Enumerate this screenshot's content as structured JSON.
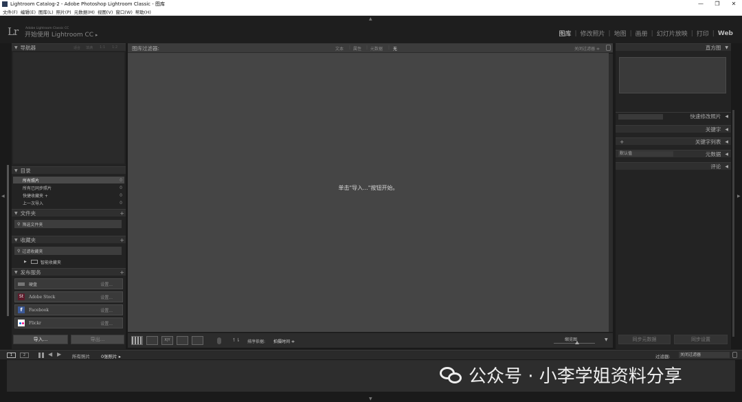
{
  "window": {
    "title": "Lightroom Catalog-2 - Adobe Photoshop Lightroom Classic - 图库",
    "controls": [
      "—",
      "❐",
      "✕"
    ]
  },
  "menu": [
    "文件(F)",
    "编辑(E)",
    "图库(L)",
    "照片(P)",
    "元数据(M)",
    "视图(V)",
    "窗口(W)",
    "帮助(H)"
  ],
  "identity": {
    "logo": "Lr",
    "sub": "Adobe Lightroom Classic CC",
    "main": "开始使用 Lightroom CC",
    "arrow": "▸"
  },
  "modules": [
    "图库",
    "修改照片",
    "地图",
    "画册",
    "幻灯片放映",
    "打印",
    "Web"
  ],
  "left": {
    "navigator": {
      "title": "导航器",
      "opts": [
        "适合",
        "填满",
        "1:1",
        "1:2"
      ]
    },
    "catalog": {
      "title": "目录",
      "items": [
        {
          "label": "所有照片",
          "count": "0"
        },
        {
          "label": "所有已同步照片",
          "count": "0"
        },
        {
          "label": "快捷收藏夹 +",
          "count": "0"
        },
        {
          "label": "上一次导入",
          "count": "0"
        }
      ]
    },
    "folders": {
      "title": "文件夹",
      "filter": "筛选文件夹"
    },
    "collections": {
      "title": "收藏夹",
      "filter": "过滤收藏夹",
      "smart": "智能收藏夹"
    },
    "publish": {
      "title": "发布服务",
      "items": [
        {
          "label": "硬盘",
          "icon": "harddisk",
          "setup": "设置..."
        },
        {
          "label": "Adobe Stock",
          "icon": "St",
          "setup": "设置..."
        },
        {
          "label": "Facebook",
          "icon": "f",
          "setup": "设置..."
        },
        {
          "label": "Flickr",
          "icon": "flickr",
          "setup": "设置..."
        }
      ]
    },
    "import_btn": "导入...",
    "export_btn": "导出..."
  },
  "filterbar": {
    "label": "图库过滤器:",
    "tabs": [
      "文本",
      "属性",
      "元数据",
      "无"
    ],
    "preset": "关闭过滤器 ≑"
  },
  "center": {
    "message": "单击\"导入...\"按钮开始。"
  },
  "toolbar": {
    "sort_label": "排序依据:",
    "sort_value": "拍摄时间 ≑",
    "thumb_label": "缩览图"
  },
  "right": {
    "histogram": "直方图",
    "sections": [
      "快速修改照片",
      "关键字",
      "关键字列表",
      "元数据",
      "评论"
    ],
    "meta_preset": "默认值",
    "sync_meta": "同步元数据",
    "sync_settings": "同步设置"
  },
  "filmstrip": {
    "source": "所有照片",
    "count": "0张照片 ▸",
    "filter_label": "过滤器:",
    "filter_value": "关闭过滤器",
    "pages": [
      "1",
      "2"
    ]
  },
  "watermark": {
    "text": "公众号 · 小李学姐资料分享"
  }
}
